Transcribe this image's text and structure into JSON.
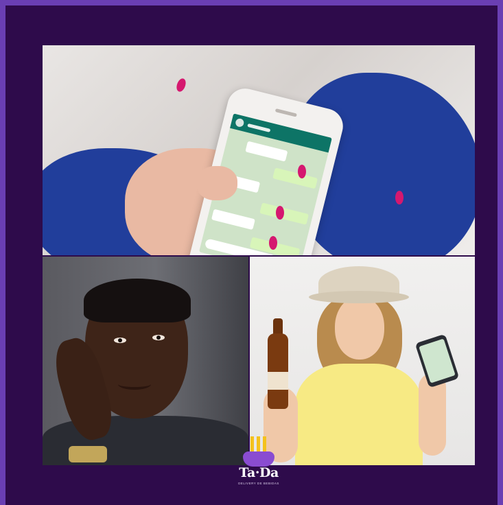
{
  "brand": {
    "logo_text": "Ta·Da",
    "logo_subtext": "Delivery de bebidas",
    "colors": {
      "outer_border": "#6a3fb3",
      "background": "#2e0b4b",
      "logo_candles": "#f4c21c",
      "logo_cake": "#8a4cd1"
    }
  },
  "panels": [
    {
      "name": "hand-holding-phone-chat",
      "icon": "smartphone-chat-icon"
    },
    {
      "name": "man-pointing-temple",
      "icon": "thinking-icon"
    },
    {
      "name": "woman-with-beer-and-phone",
      "icon": "beer-bottle-icon"
    }
  ]
}
